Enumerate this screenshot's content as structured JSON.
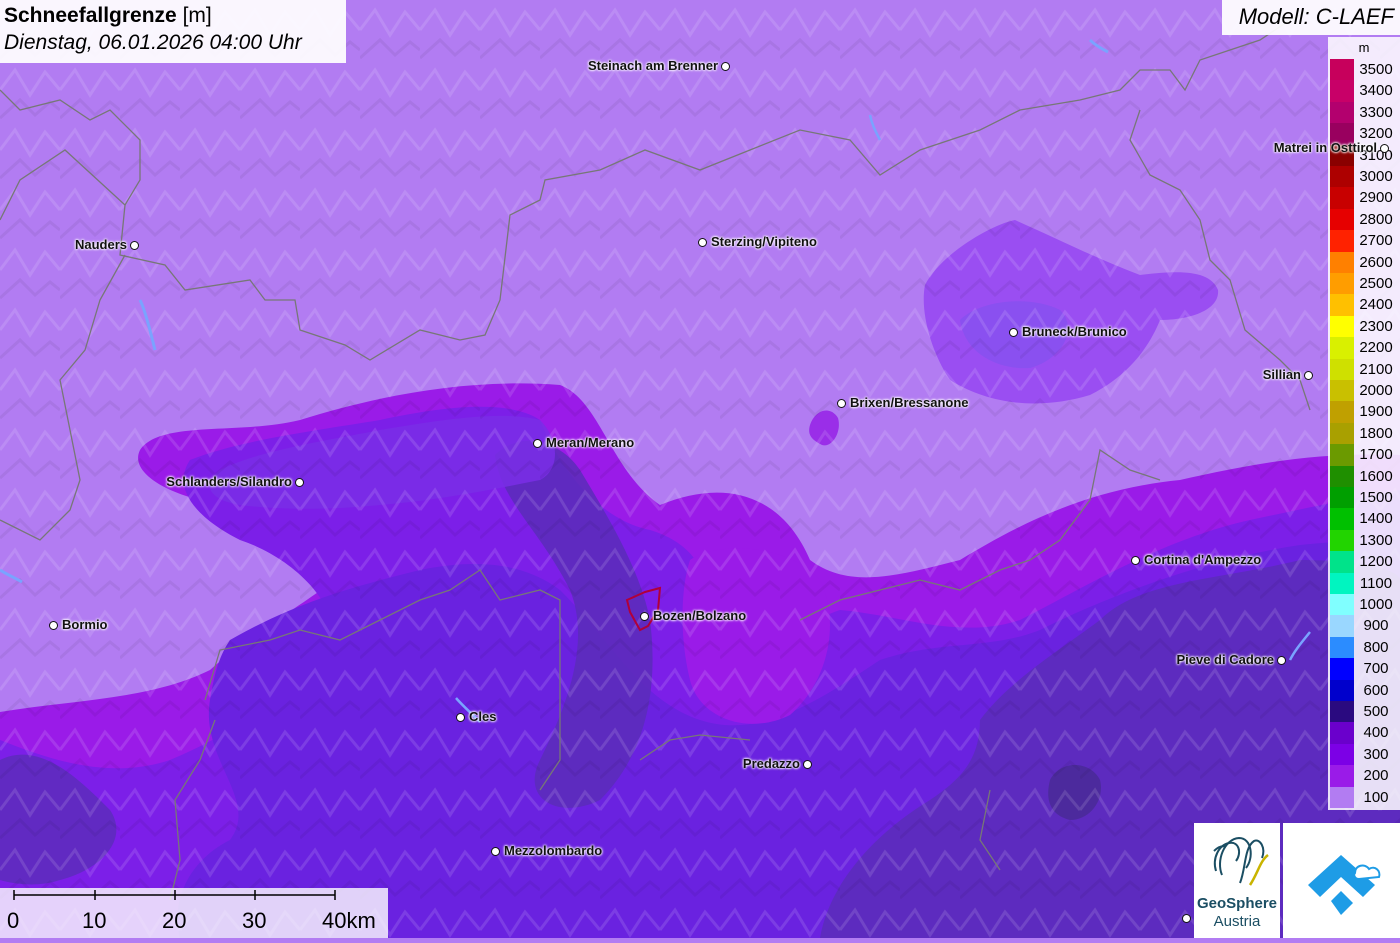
{
  "title": {
    "variable": "Schneefallgrenze",
    "unit": "[m]",
    "datetime": "Dienstag, 06.01.2026 04:00 Uhr"
  },
  "model": "Modell: C-LAEF",
  "legend": {
    "unit": "m",
    "items": [
      {
        "label": "3500",
        "color": "#c7005c"
      },
      {
        "label": "3400",
        "color": "#c80068"
      },
      {
        "label": "3300",
        "color": "#b3006e"
      },
      {
        "label": "3200",
        "color": "#99005f"
      },
      {
        "label": "3100",
        "color": "#8a0000"
      },
      {
        "label": "3000",
        "color": "#ad0000"
      },
      {
        "label": "2900",
        "color": "#c80000"
      },
      {
        "label": "2800",
        "color": "#e60000"
      },
      {
        "label": "2700",
        "color": "#ff2200"
      },
      {
        "label": "2600",
        "color": "#ff8000"
      },
      {
        "label": "2500",
        "color": "#ff9d00"
      },
      {
        "label": "2400",
        "color": "#ffc000"
      },
      {
        "label": "2300",
        "color": "#ffff00"
      },
      {
        "label": "2200",
        "color": "#d9f000"
      },
      {
        "label": "2100",
        "color": "#cfe000"
      },
      {
        "label": "2000",
        "color": "#c9c000"
      },
      {
        "label": "1900",
        "color": "#c0a000"
      },
      {
        "label": "1800",
        "color": "#a9a000"
      },
      {
        "label": "1700",
        "color": "#6b9a00"
      },
      {
        "label": "1600",
        "color": "#1f8f00"
      },
      {
        "label": "1500",
        "color": "#009f00"
      },
      {
        "label": "1400",
        "color": "#00c000"
      },
      {
        "label": "1300",
        "color": "#22d400"
      },
      {
        "label": "1200",
        "color": "#00e38a"
      },
      {
        "label": "1100",
        "color": "#00f5c0"
      },
      {
        "label": "1000",
        "color": "#80ffff"
      },
      {
        "label": "900",
        "color": "#9ad7ff"
      },
      {
        "label": "800",
        "color": "#2b8cff"
      },
      {
        "label": "700",
        "color": "#0000ff"
      },
      {
        "label": "600",
        "color": "#0000cc"
      },
      {
        "label": "500",
        "color": "#2a0a80"
      },
      {
        "label": "400",
        "color": "#6a00cc"
      },
      {
        "label": "300",
        "color": "#7c00e6"
      },
      {
        "label": "200",
        "color": "#9a1be8"
      },
      {
        "label": "100",
        "color": "#b27cf2"
      }
    ]
  },
  "cities": [
    {
      "name": "Steinach am Brenner",
      "side": "left"
    },
    {
      "name": "Nauders",
      "side": "left"
    },
    {
      "name": "Sterzing/Vipiteno",
      "side": "right"
    },
    {
      "name": "Matrei in Osttirol",
      "side": "left"
    },
    {
      "name": "Bruneck/Brunico",
      "side": "right"
    },
    {
      "name": "Sillian",
      "side": "left"
    },
    {
      "name": "Brixen/Bressanone",
      "side": "right"
    },
    {
      "name": "Meran/Merano",
      "side": "right"
    },
    {
      "name": "Schlanders/Silandro",
      "side": "left"
    },
    {
      "name": "Cortina d'Ampezzo",
      "side": "right"
    },
    {
      "name": "Bormio",
      "side": "right"
    },
    {
      "name": "Bozen/Bolzano",
      "side": "right"
    },
    {
      "name": "Pieve di Cadore",
      "side": "left"
    },
    {
      "name": "Cles",
      "side": "right"
    },
    {
      "name": "Predazzo",
      "side": "left"
    },
    {
      "name": "Mezzolombardo",
      "side": "right"
    }
  ],
  "scale": {
    "labels": [
      "0",
      "10",
      "20",
      "30",
      "40km"
    ]
  },
  "logos": {
    "geosphere": {
      "line1": "GeoSphere",
      "line2": "Austria"
    }
  }
}
